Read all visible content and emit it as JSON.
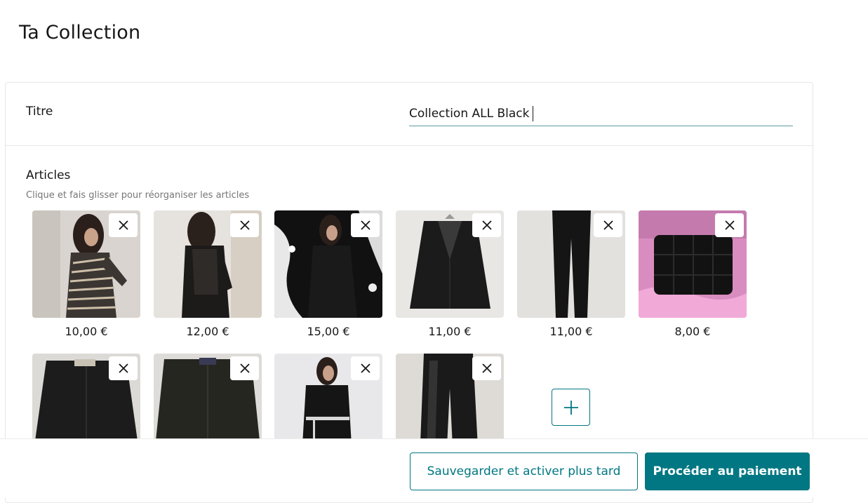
{
  "page": {
    "title": "Ta Collection"
  },
  "form": {
    "title_label": "Titre",
    "title_value": "Collection ALL Black",
    "articles_label": "Articles",
    "articles_hint": "Clique et fais glisser pour réorganiser les articles"
  },
  "items": [
    {
      "price": "10,00 €",
      "image": "striped-dress-photo"
    },
    {
      "price": "12,00 €",
      "image": "leather-dress-photo"
    },
    {
      "price": "15,00 €",
      "image": "black-wrap-dress-photo"
    },
    {
      "price": "11,00 €",
      "image": "black-blazer-photo"
    },
    {
      "price": "11,00 €",
      "image": "black-trousers-photo"
    },
    {
      "price": "8,00 €",
      "image": "quilted-bag-photo"
    },
    {
      "price": "",
      "image": "black-bomber-jacket-photo"
    },
    {
      "price": "",
      "image": "olive-bomber-jacket-photo"
    },
    {
      "price": "",
      "image": "black-blazer-dress-photo"
    },
    {
      "price": "",
      "image": "leather-pants-photo"
    }
  ],
  "footer": {
    "save_later_label": "Sauvegarder et activer plus tard",
    "pay_label": "Procéder au paiement"
  },
  "colors": {
    "accent": "#007782",
    "border": "#e6e6e6",
    "hint": "#767676"
  },
  "icons": {
    "remove": "close-icon",
    "add": "plus-icon"
  }
}
